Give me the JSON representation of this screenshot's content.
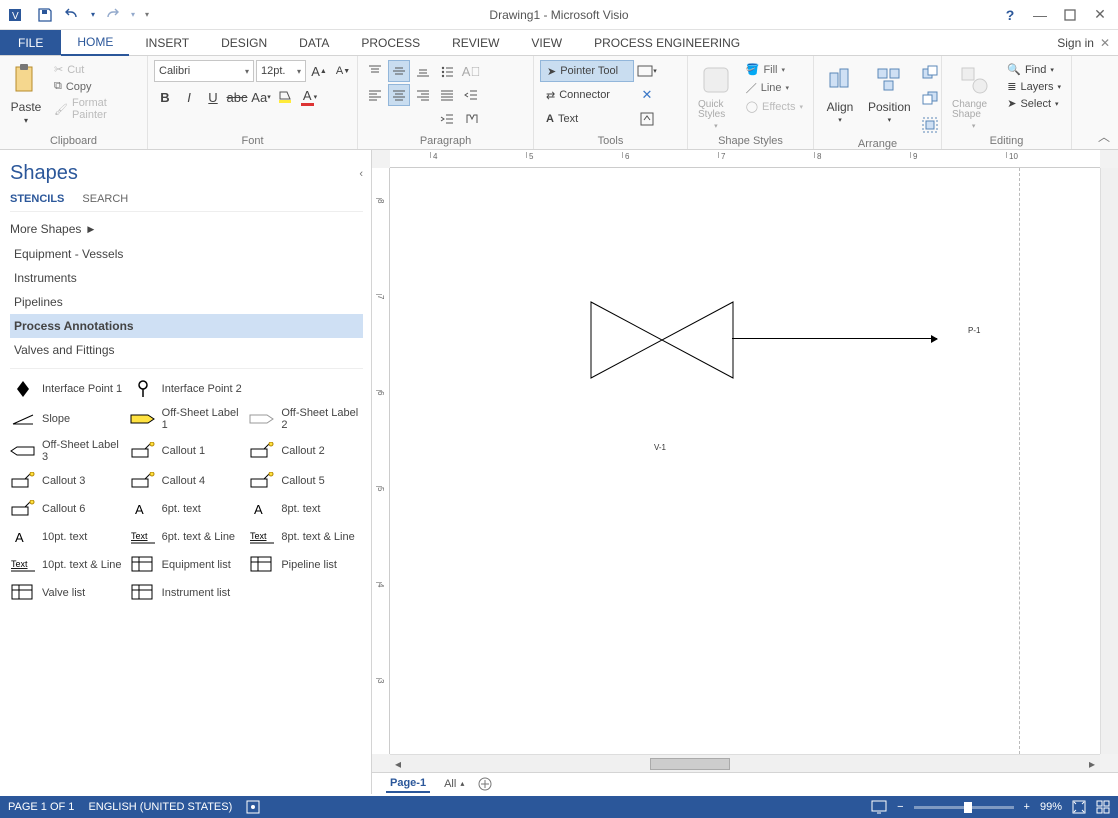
{
  "app": {
    "title": "Drawing1 - Microsoft Visio",
    "signin": "Sign in"
  },
  "qat": {
    "save": "save",
    "undo": "undo",
    "redo": "redo"
  },
  "tabs": {
    "file": "FILE",
    "home": "HOME",
    "insert": "INSERT",
    "design": "DESIGN",
    "data": "DATA",
    "process": "PROCESS",
    "review": "REVIEW",
    "view": "VIEW",
    "proc_eng": "PROCESS ENGINEERING"
  },
  "ribbon": {
    "clipboard": {
      "label": "Clipboard",
      "paste": "Paste",
      "cut": "Cut",
      "copy": "Copy",
      "format_painter": "Format Painter"
    },
    "font": {
      "label": "Font",
      "family": "Calibri",
      "size": "12pt."
    },
    "paragraph": {
      "label": "Paragraph"
    },
    "tools": {
      "label": "Tools",
      "pointer": "Pointer Tool",
      "connector": "Connector",
      "text": "Text"
    },
    "shape_styles": {
      "label": "Shape Styles",
      "quick": "Quick Styles",
      "fill": "Fill",
      "line": "Line",
      "effects": "Effects"
    },
    "arrange": {
      "label": "Arrange",
      "align": "Align",
      "position": "Position"
    },
    "editing": {
      "label": "Editing",
      "change_shape": "Change Shape",
      "find": "Find",
      "layers": "Layers",
      "select": "Select"
    }
  },
  "shapes": {
    "title": "Shapes",
    "tab_stencils": "STENCILS",
    "tab_search": "SEARCH",
    "more": "More Shapes",
    "stencils": [
      "Equipment - Vessels",
      "Instruments",
      "Pipelines",
      "Process Annotations",
      "Valves and Fittings"
    ],
    "active_stencil_index": 3,
    "items": [
      [
        "Interface Point 1",
        "Interface Point 2",
        ""
      ],
      [
        "Slope",
        "Off-Sheet Label 1",
        "Off-Sheet Label 2"
      ],
      [
        "Off-Sheet Label 3",
        "Callout 1",
        "Callout 2"
      ],
      [
        "Callout 3",
        "Callout 4",
        "Callout 5"
      ],
      [
        "Callout 6",
        "6pt. text",
        "8pt. text"
      ],
      [
        "10pt. text",
        "6pt. text & Line",
        "8pt. text & Line"
      ],
      [
        "10pt. text & Line",
        "Equipment list",
        "Pipeline list"
      ],
      [
        "Valve list",
        "Instrument list",
        ""
      ]
    ]
  },
  "canvas": {
    "valve_label": "V-1",
    "pipe_label": "P-1",
    "ruler_h": [
      "4",
      "5",
      "6",
      "7",
      "8",
      "9",
      "10"
    ],
    "ruler_v": [
      "8",
      "7",
      "6",
      "5",
      "4",
      "3"
    ]
  },
  "pages": {
    "page1": "Page-1",
    "all": "All",
    "add": "+"
  },
  "status": {
    "page": "PAGE 1 OF 1",
    "lang": "ENGLISH (UNITED STATES)",
    "zoom": "99%"
  }
}
